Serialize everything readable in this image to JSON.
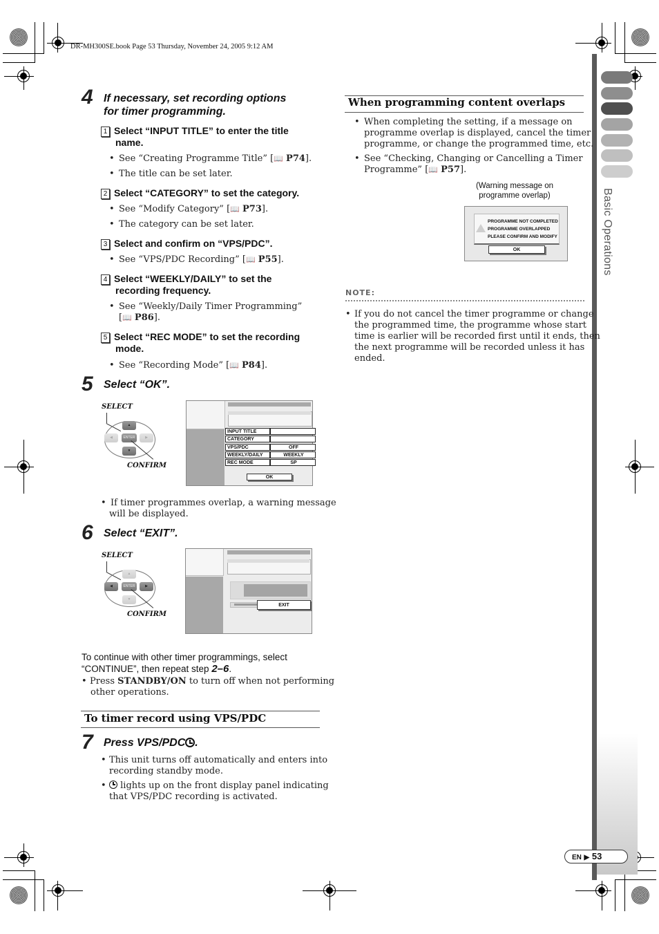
{
  "header": {
    "file_info": "DR-MH300SE.book  Page 53  Thursday, November 24, 2005  9:12 AM"
  },
  "side_tab": {
    "label": "Basic Operations",
    "tab_colors": [
      "#7a7a7a",
      "#8e8e8e",
      "#4f4f4f",
      "#a4a4a4",
      "#b2b2b2",
      "#bfbfbf",
      "#cdcdcd"
    ]
  },
  "step4": {
    "number": "4",
    "title_line1": "If necessary, set recording options",
    "title_line2": "for timer programming.",
    "substeps": [
      {
        "num": "1",
        "head_line1": "Select “INPUT TITLE” to enter the title",
        "head_line2": "name.",
        "bullets": [
          {
            "text": "See “Creating Programme Title” [",
            "ref": "P74",
            "end": "]."
          },
          {
            "text": "The title can be set later."
          }
        ]
      },
      {
        "num": "2",
        "head_line1": "Select “CATEGORY” to set the category.",
        "bullets": [
          {
            "text": "See “Modify Category” [",
            "ref": "P73",
            "end": "]."
          },
          {
            "text": "The category can be set later."
          }
        ]
      },
      {
        "num": "3",
        "head_line1": "Select and confirm on “VPS/PDC”.",
        "bullets": [
          {
            "text": "See “VPS/PDC Recording” [",
            "ref": "P55",
            "end": "]."
          }
        ]
      },
      {
        "num": "4",
        "head_line1": "Select “WEEKLY/DAILY” to set the",
        "head_line2": "recording frequency.",
        "bullets": [
          {
            "text": "See “Weekly/Daily Timer Programming”",
            "text2": "[",
            "ref": "P86",
            "end": "]."
          }
        ]
      },
      {
        "num": "5",
        "head_line1": "Select “REC MODE” to set the recording",
        "head_line2": "mode.",
        "bullets": [
          {
            "text": "See “Recording Mode” [",
            "ref": "P84",
            "end": "]."
          }
        ]
      }
    ]
  },
  "step5": {
    "number": "5",
    "title": "Select “OK”.",
    "remote": {
      "select_label": "SELECT",
      "confirm_label": "CONFIRM",
      "enter_label": "ENTER"
    },
    "screen": {
      "rows": [
        {
          "label": "INPUT TITLE",
          "value": ""
        },
        {
          "label": "CATEGORY",
          "value": ""
        },
        {
          "label": "VPS/PDC",
          "value": "OFF"
        },
        {
          "label": "WEEKLY/DAILY",
          "value": "WEEKLY"
        },
        {
          "label": "REC MODE",
          "value": "SP"
        }
      ],
      "ok_label": "OK"
    },
    "bullet_line1": "If timer programmes overlap, a warning message",
    "bullet_line2": "will be displayed."
  },
  "step6": {
    "number": "6",
    "title": "Select “EXIT”.",
    "remote": {
      "select_label": "SELECT",
      "confirm_label": "CONFIRM",
      "enter_label": "ENTER"
    },
    "screen": {
      "exit_label": "EXIT"
    }
  },
  "continue_text": {
    "line1": "To continue with other timer programmings, select",
    "line2_pre": "“CONTINUE”, then repeat step ",
    "step_range": "2–6",
    "line2_post": ".",
    "bullet_pre": "Press ",
    "bullet_bold": "STANDBY/ON",
    "bullet_post": " to turn off when not performing",
    "bullet_line2": "other operations."
  },
  "vps_section": {
    "title": "To timer record using VPS/PDC",
    "step_number": "7",
    "step_title": "Press VPS/PDC",
    "step_title_end": ".",
    "bullets": [
      {
        "line1": "This unit turns off automatically and enters into",
        "line2": "recording standby mode."
      },
      {
        "line1": " lights up on the front display panel indicating",
        "line2": "that VPS/PDC recording is activated."
      }
    ]
  },
  "overlap_section": {
    "title": "When programming content overlaps",
    "bullets": [
      {
        "line1": "When completing the setting, if a message on",
        "line2": "programme overlap is displayed, cancel the timer",
        "line3": "programme, or change the programmed time, etc."
      },
      {
        "line1": "See “Checking, Changing or Cancelling a Timer",
        "line2_pre": "Programme” [",
        "ref": "P57",
        "end": "]."
      }
    ],
    "caption_line1": "(Warning message on",
    "caption_line2": "programme overlap)",
    "warning": {
      "line1": "PROGRAMME NOT COMPLETED",
      "line2": "PROGRAMME OVERLAPPED",
      "line3": "PLEASE CONFIRM AND MODIFY",
      "ok_label": "OK"
    }
  },
  "note": {
    "label": "NOTE:",
    "lines": [
      "If you do not cancel the timer programme or change",
      "the programmed time, the programme whose start",
      "time is earlier will be recorded first until it ends, then",
      "the next programme will be recorded unless it has",
      "ended."
    ]
  },
  "page_badge": {
    "lang": "EN",
    "arrow": "▶",
    "page": "53"
  }
}
